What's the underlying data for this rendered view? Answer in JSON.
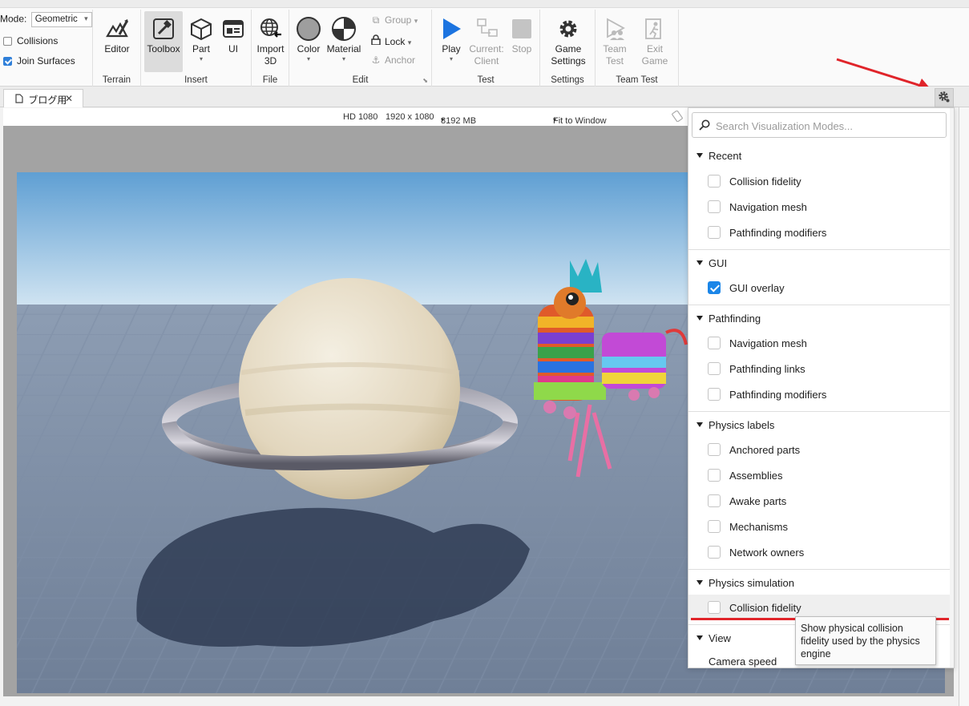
{
  "ribbon": {
    "mode_label": "Mode:",
    "mode_value": "Geometric",
    "collisions_label": "Collisions",
    "collisions_checked": false,
    "join_surfaces_label": "Join Surfaces",
    "join_surfaces_checked": true,
    "terrain": {
      "editor_label": "Editor",
      "group_label": "Terrain"
    },
    "insert": {
      "toolbox_label": "Toolbox",
      "part_label": "Part",
      "ui_label": "UI",
      "group_label": "Insert"
    },
    "file": {
      "import_label_1": "Import",
      "import_label_2": "3D",
      "group_label": "File"
    },
    "edit": {
      "color_label": "Color",
      "material_label": "Material",
      "group_label": "Edit",
      "group_item": "Group",
      "lock_item": "Lock",
      "anchor_item": "Anchor"
    },
    "test": {
      "play_label": "Play",
      "current_label_1": "Current:",
      "current_label_2": "Client",
      "stop_label": "Stop",
      "group_label": "Test"
    },
    "settings": {
      "game_settings_1": "Game",
      "game_settings_2": "Settings",
      "group_label": "Settings"
    },
    "team_test": {
      "team_test_1": "Team",
      "team_test_2": "Test",
      "exit_game_1": "Exit",
      "exit_game_2": "Game",
      "group_label": "Team Test"
    }
  },
  "tab": {
    "label": "ブログ用",
    "close": "✕"
  },
  "viewport": {
    "resolution": "HD 1080",
    "size": "1920 x 1080",
    "memory": "8192 MB",
    "fit": "Fit to Window"
  },
  "viz_modes": {
    "search_placeholder": "Search Visualization Modes...",
    "sections": [
      {
        "title": "Recent",
        "items": [
          {
            "label": "Collision fidelity",
            "checked": false
          },
          {
            "label": "Navigation mesh",
            "checked": false
          },
          {
            "label": "Pathfinding modifiers",
            "checked": false
          }
        ]
      },
      {
        "title": "GUI",
        "items": [
          {
            "label": "GUI overlay",
            "checked": true
          }
        ]
      },
      {
        "title": "Pathfinding",
        "items": [
          {
            "label": "Navigation mesh",
            "checked": false
          },
          {
            "label": "Pathfinding links",
            "checked": false
          },
          {
            "label": "Pathfinding modifiers",
            "checked": false
          }
        ]
      },
      {
        "title": "Physics labels",
        "items": [
          {
            "label": "Anchored parts",
            "checked": false
          },
          {
            "label": "Assemblies",
            "checked": false
          },
          {
            "label": "Awake parts",
            "checked": false
          },
          {
            "label": "Mechanisms",
            "checked": false
          },
          {
            "label": "Network owners",
            "checked": false
          }
        ]
      },
      {
        "title": "Physics simulation",
        "items": [
          {
            "label": "Collision fidelity",
            "checked": false
          }
        ]
      },
      {
        "title": "View",
        "items": []
      }
    ],
    "camera_speed": "Camera speed",
    "tooltip": "Show physical collision fidelity used by the physics engine"
  },
  "colors": {
    "accent_blue": "#1b86e8",
    "highlight_red": "#e0242a",
    "play_blue": "#1c74e0"
  }
}
